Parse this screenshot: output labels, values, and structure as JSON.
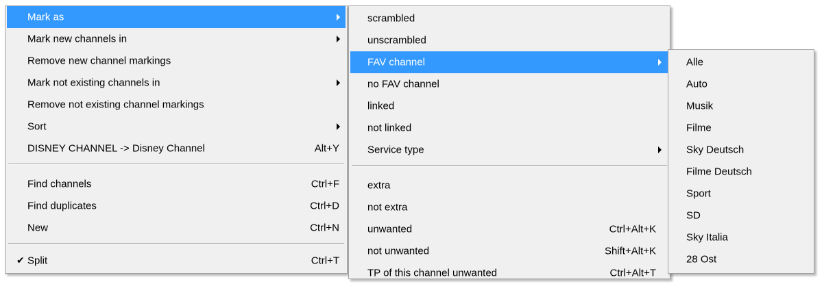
{
  "main_menu": {
    "mark_as": "Mark as",
    "mark_new_channels_in": "Mark new channels in",
    "remove_new_channel_markings": "Remove new channel markings",
    "mark_not_existing_channels_in": "Mark not existing channels in",
    "remove_not_existing_channel_markings": "Remove not existing channel markings",
    "sort": "Sort",
    "rename_item": "DISNEY CHANNEL -> Disney Channel",
    "rename_shortcut": "Alt+Y",
    "find_channels": "Find channels",
    "find_channels_shortcut": "Ctrl+F",
    "find_duplicates": "Find duplicates",
    "find_duplicates_shortcut": "Ctrl+D",
    "new": "New",
    "new_shortcut": "Ctrl+N",
    "split": "Split",
    "split_shortcut": "Ctrl+T",
    "split_checked": true
  },
  "mark_as_menu": {
    "scrambled": "scrambled",
    "unscrambled": "unscrambled",
    "fav_channel": "FAV channel",
    "no_fav_channel": "no FAV channel",
    "linked": "linked",
    "not_linked": "not linked",
    "service_type": "Service type",
    "extra": "extra",
    "not_extra": "not extra",
    "unwanted": "unwanted",
    "unwanted_shortcut": "Ctrl+Alt+K",
    "not_unwanted": "not unwanted",
    "not_unwanted_shortcut": "Shift+Alt+K",
    "tp_unwanted": "TP of this channel unwanted",
    "tp_unwanted_shortcut": "Ctrl+Alt+T"
  },
  "fav_menu": {
    "items": [
      "Alle",
      "Auto",
      "Musik",
      "Filme",
      "Sky Deutsch",
      "Filme Deutsch",
      "Sport",
      "SD",
      "Sky Italia",
      "28 Ost"
    ]
  },
  "colors": {
    "highlight": "#3399ff",
    "menu_background": "#f0f0f0"
  }
}
